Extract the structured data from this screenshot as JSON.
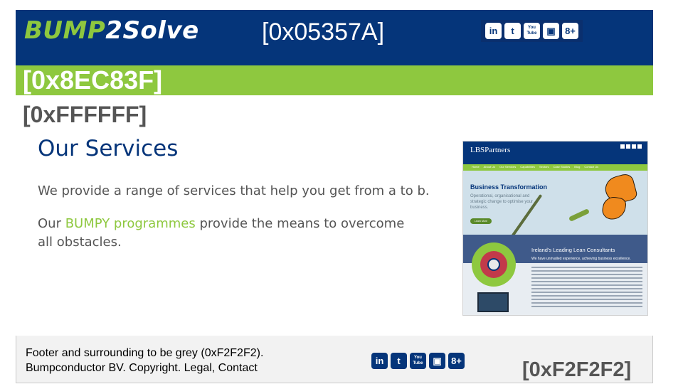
{
  "header": {
    "brand_part1": "BUMP",
    "brand_part2": "2Solve",
    "color_code": "[0x05357A]",
    "social_icons": [
      "in",
      "t",
      "You Tube",
      "▣",
      "8+"
    ]
  },
  "green_band": {
    "color_code": "[0x8EC83F]"
  },
  "content": {
    "color_code": "[0xFFFFFF]",
    "title": "Our Services",
    "paragraph1": "We provide a range of services that help you get from a to b.",
    "paragraph2_pre": "Our ",
    "paragraph2_link": "BUMPY programmes",
    "paragraph2_post": " provide the means to overcome all obstacles."
  },
  "thumbnail": {
    "logo": "LBSPartners",
    "nav": [
      "Home",
      "About Us",
      "Our Services",
      "Capabilities",
      "Sectors",
      "Case Studies",
      "Blog",
      "Contact Us"
    ],
    "hero_title": "Business Transformation",
    "hero_sub": "Operational, organisational and strategic change to optimise your business.",
    "learn_more": "Learn More",
    "lower_title": "Ireland's Leading Lean Consultants",
    "lower_sub": "We have unrivalled experience, achieving business excellence."
  },
  "footer": {
    "line1": "Footer and surrounding to be grey (0xF2F2F2).",
    "line2": "Bumpconductor BV. Copyright. Legal, Contact",
    "color_code": "[0xF2F2F2]"
  },
  "colors": {
    "navy": "#05357A",
    "green": "#8EC83F",
    "white": "#FFFFFF",
    "grey": "#F2F2F2"
  }
}
